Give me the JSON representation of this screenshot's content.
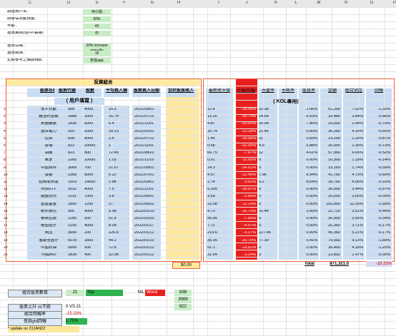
{
  "column_headers": [
    "C",
    "D",
    "E",
    "F",
    "G",
    "H",
    "I",
    "J",
    "K",
    "L",
    "M",
    "N",
    "O",
    "P"
  ],
  "settings": {
    "rows": [
      {
        "label": "設投用戶名：",
        "value": "何小姐"
      },
      {
        "label": "股票佔流動資產：",
        "value": "50%"
      },
      {
        "label": "年齡：",
        "value": "43"
      },
      {
        "label": "投資風險(短/中/長線)",
        "value": "中"
      },
      {
        "label": "投資目標：",
        "value": "20% increase annually"
      },
      {
        "label": "投資期限：",
        "value": "10"
      },
      {
        "label": "近期參考之備股App：",
        "value": "秒投app"
      }
    ]
  },
  "left_table": {
    "title": "投資組合",
    "headers": [
      "股票名稱",
      "股票代號",
      "股數",
      "平均買入價",
      "股票買入日期",
      "合計股息收入"
    ],
    "subheader": "( 用戶填寫 )",
    "total": "$0.00",
    "rows": [
      [
        "信义光能",
        "968",
        "4000",
        "15.3",
        "2021/09/01"
      ],
      [
        "建滔积层板",
        "1888",
        "2000",
        "16.74",
        "2021/07/12"
      ],
      [
        "美團醫療",
        "1830",
        "6000",
        "6.4",
        "2021/11/01"
      ],
      [
        "滬深電力",
        "916",
        "2000",
        "18.13",
        "2022/01/01"
      ],
      [
        "远和",
        "838",
        "8000",
        "2.4",
        "2021/07/12"
      ],
      [
        "喜瑞",
        "822",
        "20000",
        "1",
        "2021/11/01"
      ],
      [
        "領展",
        "823",
        "800",
        "72.45",
        "2021/08/23"
      ],
      [
        "萬季",
        "2265",
        "10000",
        "1.03",
        "2021/11/19"
      ],
      [
        "中國首科",
        "3069",
        "700",
        "21.67",
        "2021/09/01"
      ],
      [
        "濃長",
        "2368",
        "8000",
        "5.22",
        "2021/07/01"
      ],
      [
        "招商局貨運",
        "1503",
        "14000",
        "2.84",
        "2021/03/01"
      ],
      [
        "科技ETF",
        "3032",
        "4000",
        "7.5",
        "2021/11/01"
      ],
      [
        "順豐房托",
        "2191",
        "7000",
        "3.8",
        "2021/05/01"
      ],
      [
        "盈富基金",
        "2800",
        "1200",
        "27",
        "2021/05/02"
      ],
      [
        "新天綠色",
        "956",
        "4000",
        "5.68",
        "2022/01/10"
      ],
      [
        "泰達控股",
        "2285",
        "500",
        "61.8",
        "2022/01/03"
      ],
      [
        "泰塑医疗",
        "2155",
        "4000",
        "8.09",
        "2022/01/17"
      ],
      [
        "美团",
        "3690",
        "200",
        "226.8",
        "2022/01/12"
      ],
      [
        "滙康至医疗",
        "6078",
        "1800",
        "44.2",
        "2022/01/10"
      ],
      [
        "中國石油",
        "9995",
        "500",
        "72.8",
        "2022/01/12"
      ],
      [
        "中國A50",
        "2839",
        "400",
        "32.08",
        "2022/01/12"
      ]
    ]
  },
  "right_table": {
    "title": "( KOL專用)",
    "headers": [
      "最新收市價",
      "升幅/跌幅",
      "市盈率",
      "市賬率",
      "股息率",
      "金額",
      "組合佔比",
      "回報"
    ],
    "total_label": "Total",
    "total_value": "871,321.0",
    "total_return": "-15.33%",
    "rows": [
      [
        "12.4",
        "-18.95%",
        "22.38",
        "",
        "2.06%",
        "61,200",
        "7.02%",
        "-1.33%"
      ],
      [
        "13.26",
        "-20.79%",
        "14.64",
        "",
        "6.03%",
        "33,480",
        "3.84%",
        "-0.80%"
      ],
      [
        "4.87",
        "-23.91%",
        "20.04",
        "",
        "7.80%",
        "25,600",
        "2.94%",
        "-0.70%"
      ],
      [
        "15.74",
        "-13.18%",
        "22.46",
        "",
        "0.00%",
        "36,260",
        "4.16%",
        "-0.55%"
      ],
      [
        "1.45",
        "-39.58%",
        "21",
        "",
        "0.83%",
        "19,200",
        "2.20%",
        "-0.87%"
      ],
      [
        "0.68",
        "-32.00%",
        "4.9",
        "",
        "5.88%",
        "20,000",
        "2.30%",
        "-0.73%"
      ],
      [
        "66.75",
        "-7.87%",
        "12",
        "",
        "4.61%",
        "57,960",
        "6.65%",
        "-0.52%"
      ],
      [
        "0.91",
        "-11.65%",
        "0",
        "",
        "0.00%",
        "10,300",
        "1.18%",
        "-0.14%"
      ],
      [
        "14.3",
        "-34.01%",
        "0",
        "",
        "0.00%",
        "15,169",
        "1.74%",
        "-0.59%"
      ],
      [
        "4.57",
        "-12.45%",
        "7.98",
        "",
        "8.94%",
        "41,760",
        "4.79%",
        "-0.60%"
      ],
      [
        "2.74",
        "-3.52%",
        "9.2",
        "",
        "8.64%",
        "39,760",
        "4.56%",
        "-0.16%"
      ],
      [
        "5.395",
        "-28.07%",
        "0",
        "",
        "0.00%",
        "30,000",
        "3.44%",
        "-0.97%"
      ],
      [
        "3.69",
        "-2.89%",
        "0",
        "",
        "0.00%",
        "26,600",
        "3.05%",
        "-0.09%"
      ],
      [
        "23.98",
        "-11.19%",
        "0",
        "",
        "0.00%",
        "193,900",
        "22.25%",
        "-2.99%"
      ],
      [
        "4.73",
        "-16.73%",
        "10.44",
        "",
        "3.43%",
        "22,720",
        "2.61%",
        "-0.44%"
      ],
      [
        "56.95",
        "-7.85%",
        "0",
        "",
        "0.00%",
        "30,900",
        "3.55%",
        "-0.34%"
      ],
      [
        "7.72",
        "-4.57%",
        "0",
        "",
        "0.00%",
        "32,360",
        "3.71%",
        "-0.17%"
      ],
      [
        "219.6",
        "-3.17%",
        "227.46",
        "",
        "0.00%",
        "45,360",
        "5.21%",
        "-0.17%"
      ],
      [
        "35.05",
        "-20.70%",
        "77.39",
        "",
        "0.41%",
        "79,560",
        "9.13%",
        "-1.89%"
      ],
      [
        "51.1",
        "-29.81%",
        "0",
        "",
        "0.00%",
        "36,400",
        "4.18%",
        "-1.25%"
      ],
      [
        "31.04",
        "-3.24%",
        "0",
        "",
        "0.00%",
        "12,832",
        "1.47%",
        "-0.05%"
      ]
    ]
  },
  "bottom": {
    "count_label": "組合股票數目",
    "count_value": "21",
    "top": "Top",
    "nil": "NIL",
    "worst": "Worst",
    "codes": [
      "838",
      "3069",
      "822"
    ],
    "updown_label": "股票上升 vs下跌",
    "updown_value": "0 VS 21",
    "return_label": "組合回報率",
    "return_value": "-15.33%",
    "hsi_label": "恆指ytd回報",
    "hsi_value": "1.75%",
    "note": "* update on 31JAN22"
  }
}
